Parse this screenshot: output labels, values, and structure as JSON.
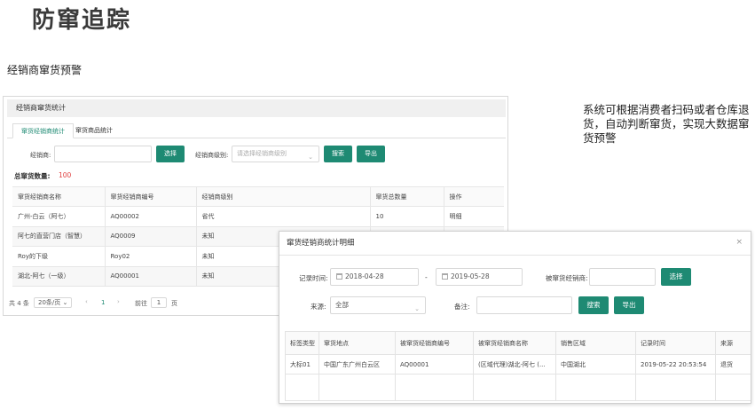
{
  "page": {
    "title": "防窜追踪",
    "subtitle": "经销商窜货预警",
    "side_note": "系统可根据消费者扫码或者仓库退货，自动判断窜货，实现大数据窜货预警"
  },
  "panel": {
    "header": "经销商窜货统计",
    "tabs": [
      "窜货经销商统计",
      "窜货商品统计"
    ],
    "filters": {
      "dealer_label": "经销商:",
      "dealer_value": "",
      "select_button": "选择",
      "level_label": "经销商级别:",
      "level_placeholder": "请选择经销商级别",
      "search_button": "搜索",
      "export_button": "导出"
    },
    "total_label": "总窜货数量:",
    "total_value": "100",
    "table": {
      "headers": [
        "窜货经销商名称",
        "窜货经销商编号",
        "经销商级别",
        "窜货总数量",
        "操作"
      ],
      "rows": [
        [
          "广州-白云（阿七）",
          "AQ00002",
          "省代",
          "10",
          "明细"
        ],
        [
          "阿七的直营门店（智慧）",
          "AQ0009",
          "未知",
          "",
          ""
        ],
        [
          "Roy的下级",
          "Roy02",
          "未知",
          "",
          ""
        ],
        [
          "湖北-阿七（一级）",
          "AQ00001",
          "未知",
          "",
          ""
        ]
      ]
    },
    "pager": {
      "total": "共 4 条",
      "page_size": "20条/页",
      "prev": "‹",
      "current": "1",
      "next": "›",
      "goto_label": "前往",
      "goto_value": "1",
      "page_suffix": "页"
    }
  },
  "dialog": {
    "title": "窜货经销商统计明细",
    "close": "×",
    "record_time_label": "记录时间:",
    "start_date": "2018-04-28",
    "range_sep": "-",
    "end_date": "2019-05-28",
    "dealer_label": "被窜货经销商:",
    "dealer_value": "",
    "select_button": "选择",
    "source_label": "来源:",
    "source_value": "全部",
    "remark_label": "备注:",
    "remark_value": "",
    "search_button": "搜索",
    "export_button": "导出",
    "table": {
      "headers": [
        "标签类型",
        "窜货地点",
        "被窜货经销商编号",
        "被窜货经销商名称",
        "销售区域",
        "记录时间",
        "来源"
      ],
      "rows": [
        [
          "大标01",
          "中国广东广州白云区",
          "AQ00001",
          "(区域代理)湖北-阿七 (...",
          "中国湖北",
          "2019-05-22 20:53:54",
          "退货"
        ]
      ]
    }
  },
  "colors": {
    "accent": "#1e8a73",
    "total_value": "#e04040"
  }
}
